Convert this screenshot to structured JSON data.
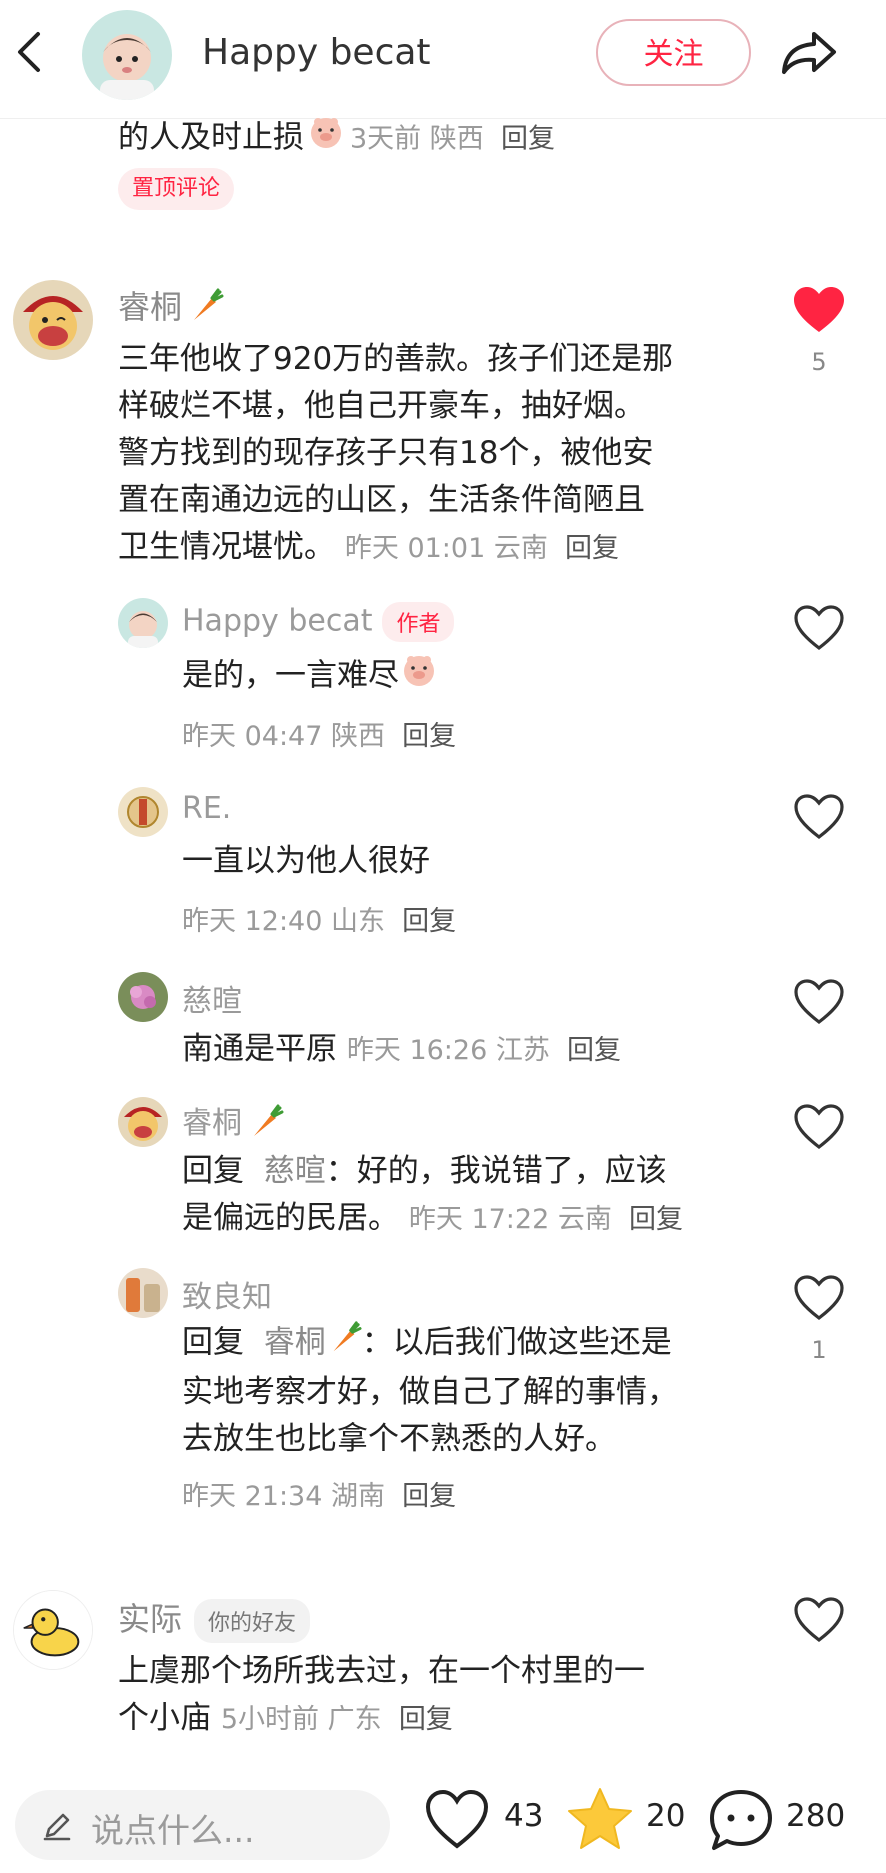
{
  "header": {
    "name": "Happy becat",
    "follow": "关注"
  },
  "pinned": {
    "text": "的人及时止损",
    "time": "3天前",
    "location": "陕西",
    "reply": "回复",
    "tag": "置顶评论"
  },
  "comments": [
    {
      "name": "睿桐",
      "lines": [
        "三年他收了920万的善款。孩子们还是那",
        "样破烂不堪，他自己开豪车，抽好烟。",
        "警方找到的现存孩子只有18个，被他安",
        "置在南通边远的山区，生活条件简陋且",
        "卫生情况堪忧。"
      ],
      "time": "昨天 01:01",
      "location": "云南",
      "reply": "回复",
      "likes": "5",
      "liked": true,
      "replies": [
        {
          "name": "Happy becat",
          "tag": "作者",
          "lines": [
            "是的，一言难尽"
          ],
          "time": "昨天 04:47",
          "location": "陕西",
          "reply": "回复"
        },
        {
          "name": "RE.",
          "lines": [
            "一直以为他人很好"
          ],
          "time": "昨天 12:40",
          "location": "山东",
          "reply": "回复"
        },
        {
          "name": "慈暄",
          "lines": [
            "南通是平原"
          ],
          "time": "昨天 16:26",
          "location": "江苏",
          "reply": "回复"
        },
        {
          "name": "睿桐",
          "reply_prefix": "回复",
          "reply_to": "慈暄",
          "lines": [
            "：好的，我说错了，应该",
            "是偏远的民居。"
          ],
          "time": "昨天 17:22",
          "location": "云南",
          "reply": "回复"
        },
        {
          "name": "致良知",
          "reply_prefix": "回复",
          "reply_to": "睿桐",
          "lines": [
            "：以后我们做这些还是",
            "实地考察才好，做自己了解的事情，",
            "去放生也比拿个不熟悉的人好。"
          ],
          "time": "昨天 21:34",
          "location": "湖南",
          "reply": "回复",
          "likes": "1"
        }
      ]
    },
    {
      "name": "实际",
      "tag": "你的好友",
      "lines": [
        "上虞那个场所我去过，在一个村里的一",
        "个小庙"
      ],
      "time": "5小时前",
      "location": "广东",
      "reply": "回复"
    }
  ],
  "bottom": {
    "placeholder": "说点什么...",
    "likes": "43",
    "stars": "20",
    "comments": "280"
  },
  "colors": {
    "accent": "#ff2442",
    "star": "#fcc93a"
  },
  "icons": [
    "back-arrow-icon",
    "share-icon",
    "heart-icon",
    "carrot-emoji-icon",
    "piggy-emoji-icon",
    "pencil-icon",
    "star-icon",
    "comment-bubble-icon"
  ]
}
